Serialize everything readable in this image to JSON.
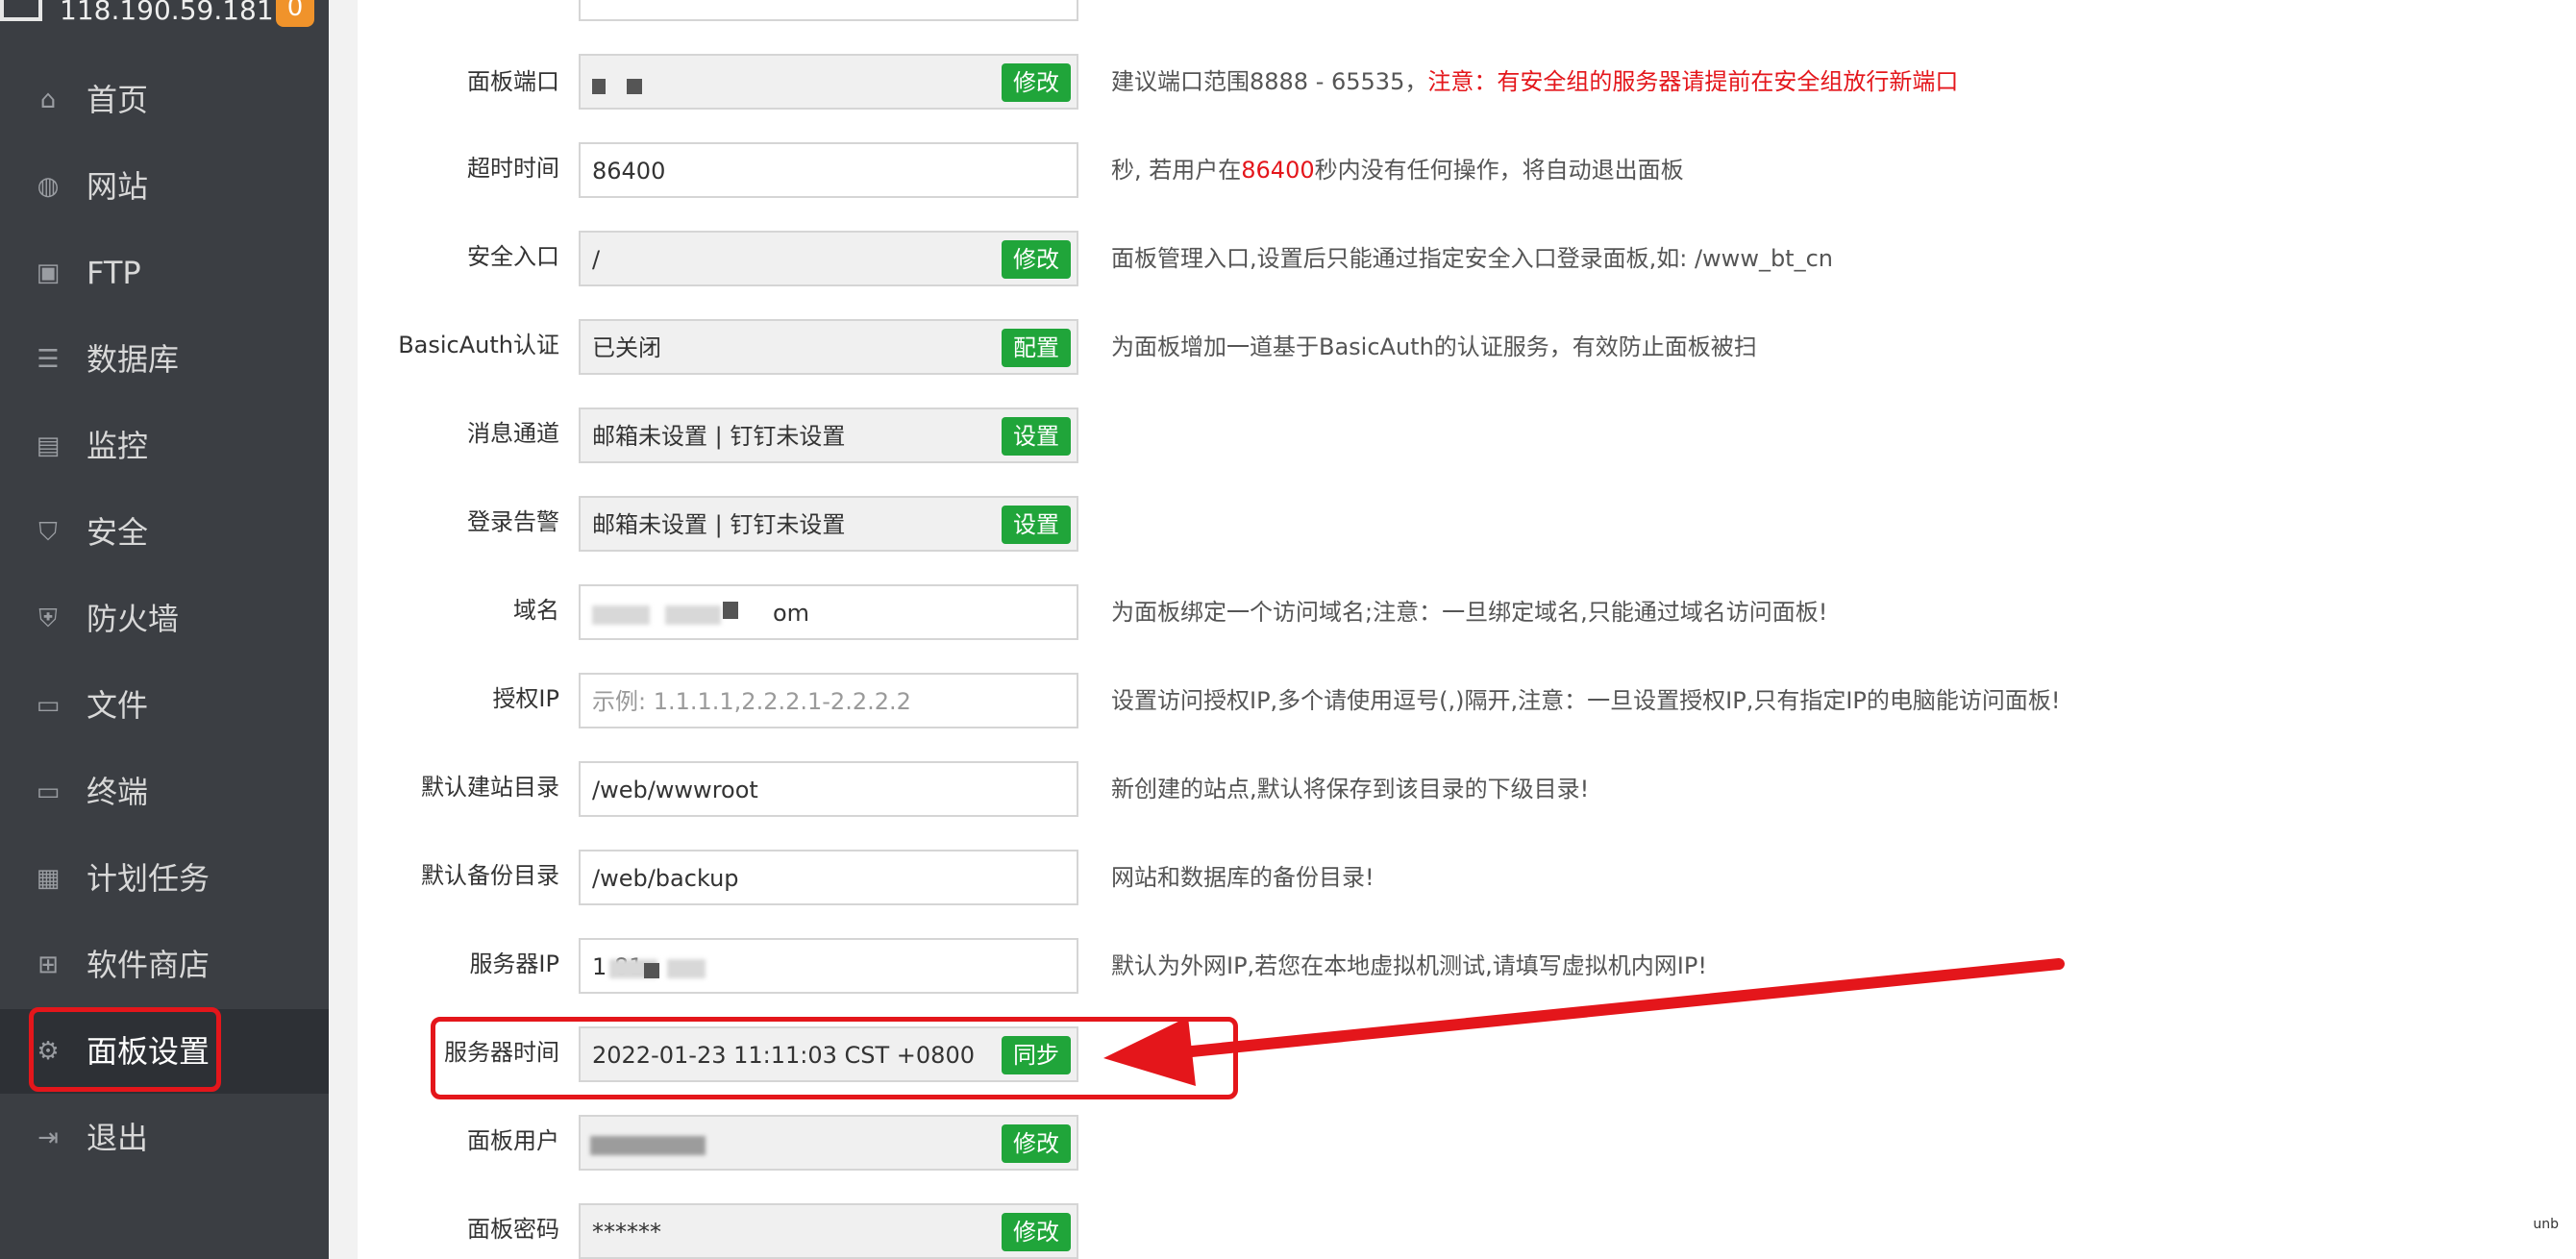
{
  "sidebar": {
    "server_ip": "118.190.59.181",
    "badge": "0",
    "items": [
      {
        "label": "首页",
        "icon": "home-icon"
      },
      {
        "label": "网站",
        "icon": "globe-icon"
      },
      {
        "label": "FTP",
        "icon": "ftp-icon"
      },
      {
        "label": "数据库",
        "icon": "database-icon"
      },
      {
        "label": "监控",
        "icon": "monitor-chart-icon"
      },
      {
        "label": "安全",
        "icon": "shield-icon"
      },
      {
        "label": "防火墙",
        "icon": "firewall-icon"
      },
      {
        "label": "文件",
        "icon": "folder-icon"
      },
      {
        "label": "终端",
        "icon": "terminal-icon"
      },
      {
        "label": "计划任务",
        "icon": "calendar-icon"
      },
      {
        "label": "软件商店",
        "icon": "apps-icon"
      },
      {
        "label": "面板设置",
        "icon": "gear-icon",
        "active": true
      },
      {
        "label": "退出",
        "icon": "logout-icon"
      }
    ]
  },
  "form": {
    "rows": [
      {
        "label": "面板端口",
        "value": "",
        "button": "修改",
        "desc": "建议端口范围8888 - 65535，",
        "desc_red": "注意：有安全组的服务器请提前在安全组放行新端口"
      },
      {
        "label": "超时时间",
        "value": "86400",
        "desc_pre": "秒, 若用户在",
        "desc_red": "86400",
        "desc_post": "秒内没有任何操作，将自动退出面板"
      },
      {
        "label": "安全入口",
        "value": "/",
        "button": "修改",
        "desc": "面板管理入口,设置后只能通过指定安全入口登录面板,如: /www_bt_cn"
      },
      {
        "label": "BasicAuth认证",
        "value": "已关闭",
        "button": "配置",
        "desc": "为面板增加一道基于BasicAuth的认证服务，有效防止面板被扫"
      },
      {
        "label": "消息通道",
        "value": "邮箱未设置 | 钉钉未设置",
        "button": "设置"
      },
      {
        "label": "登录告警",
        "value": "邮箱未设置 | 钉钉未设置",
        "button": "设置"
      },
      {
        "label": "域名",
        "value": "om",
        "desc": "为面板绑定一个访问域名;注意：一旦绑定域名,只能通过域名访问面板!"
      },
      {
        "label": "授权IP",
        "placeholder": "示例: 1.1.1.1,2.2.2.1-2.2.2.2",
        "desc": "设置访问授权IP,多个请使用逗号(,)隔开,注意：一旦设置授权IP,只有指定IP的电脑能访问面板!"
      },
      {
        "label": "默认建站目录",
        "value": "/web/wwwroot",
        "desc": "新创建的站点,默认将保存到该目录的下级目录!"
      },
      {
        "label": "默认备份目录",
        "value": "/web/backup",
        "desc": "网站和数据库的备份目录!"
      },
      {
        "label": "服务器IP",
        "value": "1          81",
        "desc": "默认为外网IP,若您在本地虚拟机测试,请填写虚拟机内网IP!"
      },
      {
        "label": "服务器时间",
        "value": "2022-01-23 11:11:03 CST +0800",
        "button": "同步"
      },
      {
        "label": "面板用户",
        "value": "",
        "button": "修改"
      },
      {
        "label": "面板密码",
        "value": "******",
        "button": "修改"
      }
    ]
  },
  "colors": {
    "sidebar_bg": "#3b3e43",
    "accent_green": "#20a53a",
    "annotation_red": "#e4161b",
    "badge_orange": "#f0932b"
  },
  "watermark": "unb"
}
